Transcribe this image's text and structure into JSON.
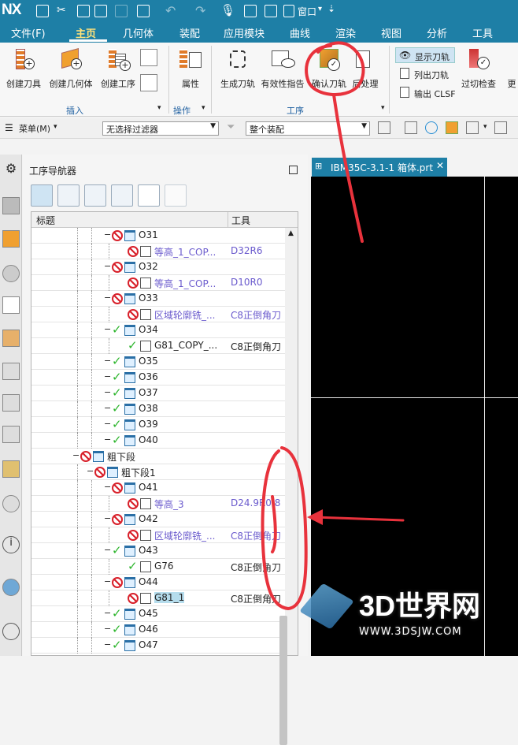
{
  "app": {
    "logo": "NX",
    "window_menu": "窗口"
  },
  "menu": {
    "tabs": [
      "文件(F)",
      "主页",
      "几何体",
      "装配",
      "应用模块",
      "曲线",
      "渲染",
      "视图",
      "分析",
      "工具"
    ],
    "active": "主页"
  },
  "ribbon": {
    "insert_buttons": [
      "创建刀具",
      "创建几何体",
      "创建工序"
    ],
    "insert_group": "插入",
    "attr_button": "属性",
    "ops_group": "操作",
    "proc_buttons": [
      "生成刀轨",
      "有效性指告",
      "确认刀轨",
      "后处理"
    ],
    "proc_group": "工序",
    "small_buttons": [
      "显示刀轨",
      "列出刀轨",
      "输出 CLSF"
    ],
    "overcut_button": "过切检查",
    "more_button": "更"
  },
  "selection_bar": {
    "menu_label": "菜单(M)",
    "filter_value": "无选择过滤器",
    "assembly_value": "整个装配"
  },
  "navigator": {
    "title": "工序导航器",
    "col_title": "标题",
    "col_tool": "工具",
    "rows": [
      {
        "name": "O31",
        "tool": "",
        "level": 2,
        "status": "red",
        "kind": "program"
      },
      {
        "name": "等高_1_COP...",
        "tool": "D32R6",
        "level": 3,
        "status": "red",
        "kind": "op",
        "purple": true
      },
      {
        "name": "O32",
        "tool": "",
        "level": 2,
        "status": "red",
        "kind": "program"
      },
      {
        "name": "等高_1_COP...",
        "tool": "D10R0",
        "level": 3,
        "status": "red",
        "kind": "op",
        "purple": true
      },
      {
        "name": "O33",
        "tool": "",
        "level": 2,
        "status": "red",
        "kind": "program"
      },
      {
        "name": "区域轮廓铣_...",
        "tool": "C8正倒角刀",
        "level": 3,
        "status": "red",
        "kind": "op",
        "purple": true
      },
      {
        "name": "O34",
        "tool": "",
        "level": 2,
        "status": "green",
        "kind": "program"
      },
      {
        "name": "G81_COPY_...",
        "tool": "C8正倒角刀",
        "level": 3,
        "status": "green",
        "kind": "op"
      },
      {
        "name": "O35",
        "tool": "",
        "level": 2,
        "status": "green",
        "kind": "program"
      },
      {
        "name": "O36",
        "tool": "",
        "level": 2,
        "status": "green",
        "kind": "program"
      },
      {
        "name": "O37",
        "tool": "",
        "level": 2,
        "status": "green",
        "kind": "program"
      },
      {
        "name": "O38",
        "tool": "",
        "level": 2,
        "status": "green",
        "kind": "program"
      },
      {
        "name": "O39",
        "tool": "",
        "level": 2,
        "status": "green",
        "kind": "program"
      },
      {
        "name": "O40",
        "tool": "",
        "level": 2,
        "status": "green",
        "kind": "program"
      },
      {
        "name": "粗下段",
        "tool": "",
        "level": 0,
        "status": "red",
        "kind": "group"
      },
      {
        "name": "粗下段1",
        "tool": "",
        "level": 1,
        "status": "red",
        "kind": "group"
      },
      {
        "name": "O41",
        "tool": "",
        "level": 2,
        "status": "red",
        "kind": "program"
      },
      {
        "name": "等高_3",
        "tool": "D24.9R0.8",
        "level": 3,
        "status": "red",
        "kind": "op",
        "purple": true
      },
      {
        "name": "O42",
        "tool": "",
        "level": 2,
        "status": "red",
        "kind": "program"
      },
      {
        "name": "区域轮廓铣_...",
        "tool": "C8正倒角刀",
        "level": 3,
        "status": "red",
        "kind": "op",
        "purple": true
      },
      {
        "name": "O43",
        "tool": "",
        "level": 2,
        "status": "green",
        "kind": "program"
      },
      {
        "name": "G76",
        "tool": "C8正倒角刀",
        "level": 3,
        "status": "green",
        "kind": "op"
      },
      {
        "name": "O44",
        "tool": "",
        "level": 2,
        "status": "red",
        "kind": "program"
      },
      {
        "name": "G81_1",
        "tool": "C8正倒角刀",
        "level": 3,
        "status": "red",
        "kind": "op",
        "selected": true
      },
      {
        "name": "O45",
        "tool": "",
        "level": 2,
        "status": "green",
        "kind": "program"
      },
      {
        "name": "O46",
        "tool": "",
        "level": 2,
        "status": "green",
        "kind": "program"
      },
      {
        "name": "O47",
        "tool": "",
        "level": 2,
        "status": "green",
        "kind": "program"
      }
    ]
  },
  "graphics_tab": {
    "title": "IBM35C-3.1-1 箱体.prt"
  },
  "watermark": {
    "brand": "3D世界网",
    "url": "WWW.3DSJW.COM"
  },
  "colors": {
    "titlebar": "#1e7fa6",
    "active_tab": "#ffe27a",
    "annotation": "#e8323c",
    "ok": "#2db52d",
    "error": "#d8202a",
    "selection": "#b5dcec"
  }
}
